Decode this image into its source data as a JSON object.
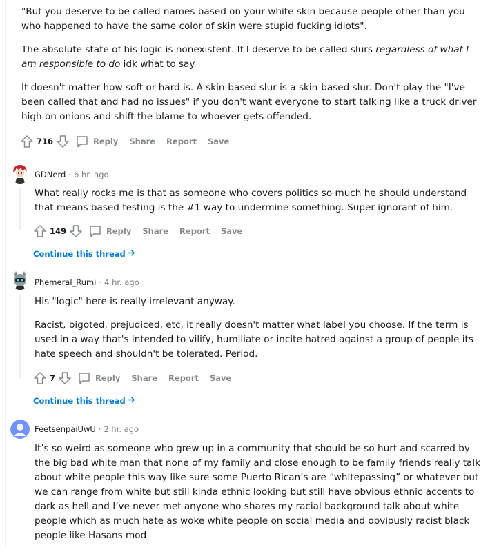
{
  "comments": [
    {
      "paragraphs": [
        "\"But you deserve to be called names based on your white skin because people other than you who happened to have the same color of skin were stupid fucking idiots\"."
      ],
      "p2_plain": "The absolute state of his logic is nonexistent. If I deserve to be called slurs ",
      "p2_italic": "regardless of what I am responsible to do",
      "p2_tail": " idk what to say.",
      "p3": "It doesn't matter how soft or hard is. A skin-based slur is a skin-based slur. Don't play the \"I've been called that and had no issues\" if you don't want everyone to start talking like a truck driver high on onions and shift the blame to whoever gets offended.",
      "votes": "716"
    },
    {
      "username": "GDNerd",
      "time": "6 hr. ago",
      "text": "What really rocks me is that as someone who covers politics so much he should understand that means based testing is the #1 way to undermine something. Super ignorant of him.",
      "votes": "149"
    },
    {
      "username": "Phemeral_Rumi",
      "time": "4 hr. ago",
      "p1": "His \"logic\" here is really irrelevant anyway.",
      "p2": "Racist, bigoted, prejudiced, etc, it really doesn't matter what label you choose. If the term is used in a way that's intended to vilify, humiliate or incite hatred against a group of people its hate speech and shouldn't be tolerated. Period.",
      "votes": "7"
    },
    {
      "username": "FeetsenpaiUwU",
      "time": "2 hr. ago",
      "text": "It’s so weird as someone who grew up in a community that should be so hurt and scarred by the big bad white man that none of my family and close enough to be family friends really talk about white people this way like sure some Puerto Rican’s are “whitepassing” or whatever but we can range from white but still kinda ethnic looking but still have obvious ethnic accents to dark as hell and I’ve never met anyone who shares my racial background talk about white people which as much hate as woke white people on social media and obviously racist black people like Hasans mod"
    }
  ],
  "actions": {
    "reply": "Reply",
    "share": "Share",
    "report": "Report",
    "save": "Save"
  },
  "separator": "·",
  "continue_label": "Continue this thread",
  "colors": {
    "link": "#0079d3",
    "meta": "#878a8c",
    "thread_line": "#edeff1"
  }
}
